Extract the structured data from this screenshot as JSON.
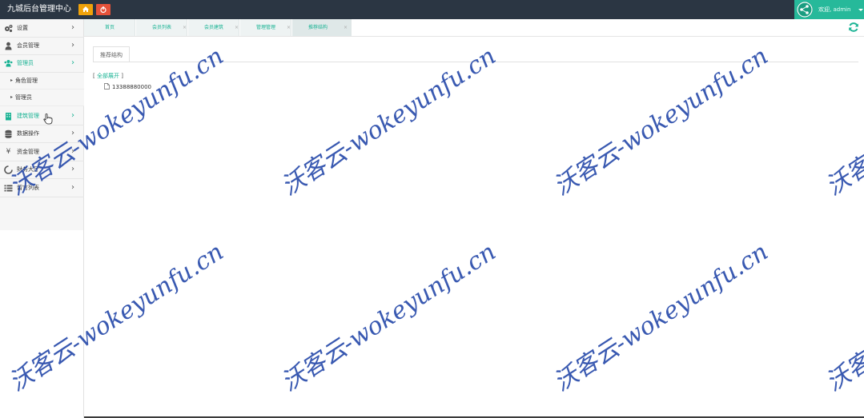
{
  "header": {
    "title": "九城后台管理中心",
    "welcome": "欢迎,",
    "user": "admin"
  },
  "sidebar": {
    "items": [
      {
        "label": "设置",
        "icon": "gears-icon"
      },
      {
        "label": "会员管理",
        "icon": "user-icon"
      },
      {
        "label": "管理员",
        "icon": "users-icon",
        "active": true
      },
      {
        "label": "建筑管理",
        "icon": "building-icon",
        "highlight": true
      },
      {
        "label": "数据操作",
        "icon": "database-icon"
      },
      {
        "label": "资金管理",
        "icon": "yen-icon"
      },
      {
        "label": "財务大厅",
        "icon": "circle-notch-icon"
      },
      {
        "label": "留言列表",
        "icon": "list-icon"
      }
    ],
    "subitems": [
      {
        "label": "角色管理"
      },
      {
        "label": "管理员"
      }
    ]
  },
  "tabs": [
    {
      "label": "首页"
    },
    {
      "label": "会员列表"
    },
    {
      "label": "会员建筑"
    },
    {
      "label": "管理管理"
    },
    {
      "label": "推荐结构",
      "active": true
    }
  ],
  "content": {
    "panel_tab": "推荐结构",
    "expand_open": "[",
    "expand_label": "全部展开",
    "expand_close": "]",
    "tree_node": "13388880000"
  },
  "watermark": {
    "text": "沃客云-wokeyunfu.cn"
  },
  "colors": {
    "topbar": "#2b3643",
    "accent": "#1ab394",
    "user_box": "#26b99a",
    "home_button": "#f0a20a",
    "power_button": "#e5523a",
    "watermark": "#2447a8"
  }
}
